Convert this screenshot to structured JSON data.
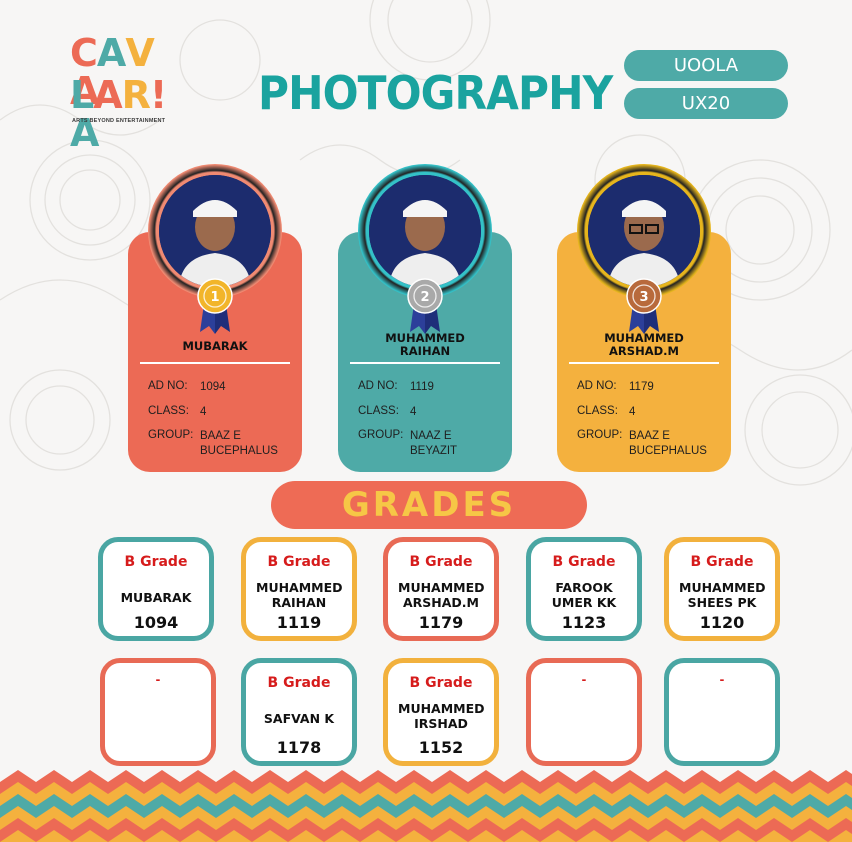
{
  "logo": {
    "line1": "CAVA",
    "line2": "LARIA",
    "tagline": "ARTS BEYOND ENTERTAINMENT"
  },
  "title": "PHOTOGRAPHY",
  "pills": {
    "category": "UOOLA",
    "code": "UX20"
  },
  "winners": [
    {
      "rank": "1",
      "name": "MUBARAK",
      "ad_label": "AD NO:",
      "ad_no": "1094",
      "class_label": "CLASS:",
      "class": "4",
      "group_label": "GROUP:",
      "group": "BAAZ E BUCEPHALUS",
      "color": "#ec6a55",
      "ring": "#f08a72",
      "medal": "#f2b52a"
    },
    {
      "rank": "2",
      "name": "MUHAMMED RAIHAN",
      "ad_label": "AD NO:",
      "ad_no": "1119",
      "class_label": "CLASS:",
      "class": "4",
      "group_label": "GROUP:",
      "group": "NAAZ E BEYAZIT",
      "color": "#4eaaa7",
      "ring": "#34c1c7",
      "medal": "#a9a9a9"
    },
    {
      "rank": "3",
      "name": "MUHAMMED ARSHAD.M",
      "ad_label": "AD NO:",
      "ad_no": "1179",
      "class_label": "CLASS:",
      "class": "4",
      "group_label": "GROUP:",
      "group": "BAAZ E BUCEPHALUS",
      "color": "#f4b13e",
      "ring": "#e6b51d",
      "medal": "#b86a3c"
    }
  ],
  "grades_title": "GRADES",
  "grades": [
    {
      "grade": "B Grade",
      "name": "MUBARAK",
      "ad": "1094",
      "border": "#4aa6a3"
    },
    {
      "grade": "B Grade",
      "name": "MUHAMMED RAIHAN",
      "ad": "1119",
      "border": "#f2b13d"
    },
    {
      "grade": "B Grade",
      "name": "MUHAMMED ARSHAD.M",
      "ad": "1179",
      "border": "#e86a55"
    },
    {
      "grade": "B Grade",
      "name": "FAROOK UMER KK",
      "ad": "1123",
      "border": "#4aa6a3"
    },
    {
      "grade": "B Grade",
      "name": "MUHAMMED SHEES PK",
      "ad": "1120",
      "border": "#f2b13d"
    },
    {
      "grade": "-",
      "name": "",
      "ad": "",
      "border": "#e86a55"
    },
    {
      "grade": "B Grade",
      "name": "SAFVAN K",
      "ad": "1178",
      "border": "#4aa6a3"
    },
    {
      "grade": "B Grade",
      "name": "MUHAMMED IRSHAD",
      "ad": "1152",
      "border": "#f2b13d"
    },
    {
      "grade": "-",
      "name": "",
      "ad": "",
      "border": "#e86a55"
    },
    {
      "grade": "-",
      "name": "",
      "ad": "",
      "border": "#4aa6a3"
    }
  ]
}
